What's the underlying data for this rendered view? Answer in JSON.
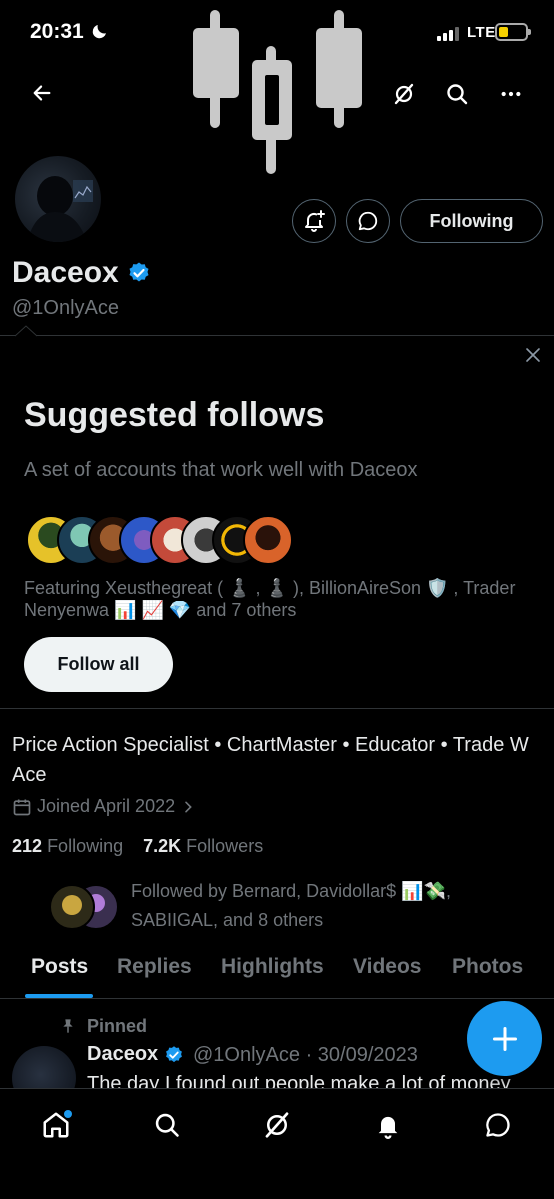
{
  "status_bar": {
    "time": "20:31",
    "network": "LTE",
    "battery_color": "#f5d000"
  },
  "header": {
    "back_icon": "arrow-left-icon",
    "grok_icon": "grok-icon",
    "search_icon": "search-icon",
    "more_icon": "more-icon"
  },
  "profile": {
    "name": "Daceox",
    "handle": "@1OnlyAce",
    "verified": true,
    "following_label": "Following",
    "bio": "Price Action Specialist • ChartMaster • Educator • Trade W Ace",
    "joined": "Joined April 2022",
    "following_count": "212",
    "following_label_text": "Following",
    "followers_count": "7.2K",
    "followers_label_text": "Followers",
    "followed_by": "Followed by Bernard, Davidollar$ 📊💸, SABIIGAL, and 8 others"
  },
  "suggested": {
    "title": "Suggested follows",
    "subtitle": "A set of accounts that work well with Daceox",
    "featuring": "Featuring Xeusthegreat ( ♟️ , ♟️ ), BillionAireSon 🛡️ , Trader Nenyenwa 📊 📈 💎 and 7 others",
    "follow_all_label": "Follow all",
    "avatar_colors": [
      "#e6c229",
      "#2f6e5e",
      "#7a3b1f",
      "#2d58c8",
      "#c44a3a",
      "#8a8a8a",
      "#f2b705",
      "#d9632a"
    ]
  },
  "tabs": [
    {
      "label": "Posts",
      "active": true
    },
    {
      "label": "Replies",
      "active": false
    },
    {
      "label": "Highlights",
      "active": false
    },
    {
      "label": "Videos",
      "active": false
    },
    {
      "label": "Photos",
      "active": false
    }
  ],
  "post": {
    "pinned_label": "Pinned",
    "author": "Daceox",
    "meta": "@1OnlyAce · 30/09/2023",
    "text": "The day I found out people make a lot of money"
  },
  "accent_color": "#1d9bf0",
  "bottom_nav": [
    "home-icon",
    "search-icon",
    "grok-icon",
    "bell-icon",
    "messages-icon"
  ]
}
